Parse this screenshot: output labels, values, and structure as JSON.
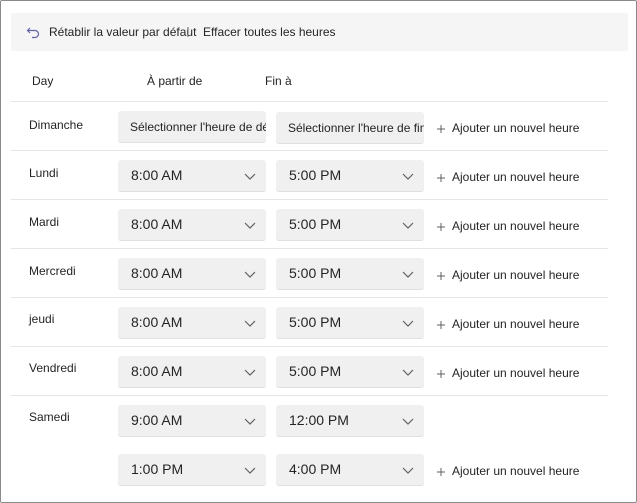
{
  "toolbar": {
    "reset_label": "Rétablir la valeur par défaut",
    "clear_label": "Effacer toutes les heures"
  },
  "headers": {
    "day": "Day",
    "from": "À partir de",
    "to": "Fin à"
  },
  "rows": [
    {
      "day": "Dimanche",
      "from": "Sélectionner l'heure de début",
      "to": "Sélectionner l'heure de fin",
      "add": "Ajouter un nouvel heure"
    },
    {
      "day": "Lundi",
      "from": "8:00 AM",
      "to": "5:00 PM",
      "add": "Ajouter un nouvel heure"
    },
    {
      "day": "Mardi",
      "from": "8:00 AM",
      "to": "5:00 PM",
      "add": "Ajouter un nouvel heure"
    },
    {
      "day": "Mercredi",
      "from": "8:00 AM",
      "to": "5:00 PM",
      "add": "Ajouter un nouvel heure"
    },
    {
      "day": "jeudi",
      "from": "8:00 AM",
      "to": "5:00 PM",
      "add": "Ajouter un nouvel heure"
    },
    {
      "day": "Vendredi",
      "from": "8:00 AM",
      "to": "5:00 PM",
      "add": "Ajouter un nouvel heure"
    },
    {
      "day": "Samedi",
      "from": "9:00 AM",
      "to": "12:00 PM",
      "from2": "1:00 PM",
      "to2": "4:00 PM",
      "add": "Ajouter un nouvel heure"
    }
  ],
  "icons": {
    "reset": "undo-arrow-icon",
    "clear": "clear-icon",
    "dropdown": "chevron-down-icon",
    "add": "plus-icon"
  },
  "colors": {
    "accent": "#6264a7",
    "field_bg": "#f0f0f0",
    "toolbar_bg": "#f5f5f5"
  }
}
